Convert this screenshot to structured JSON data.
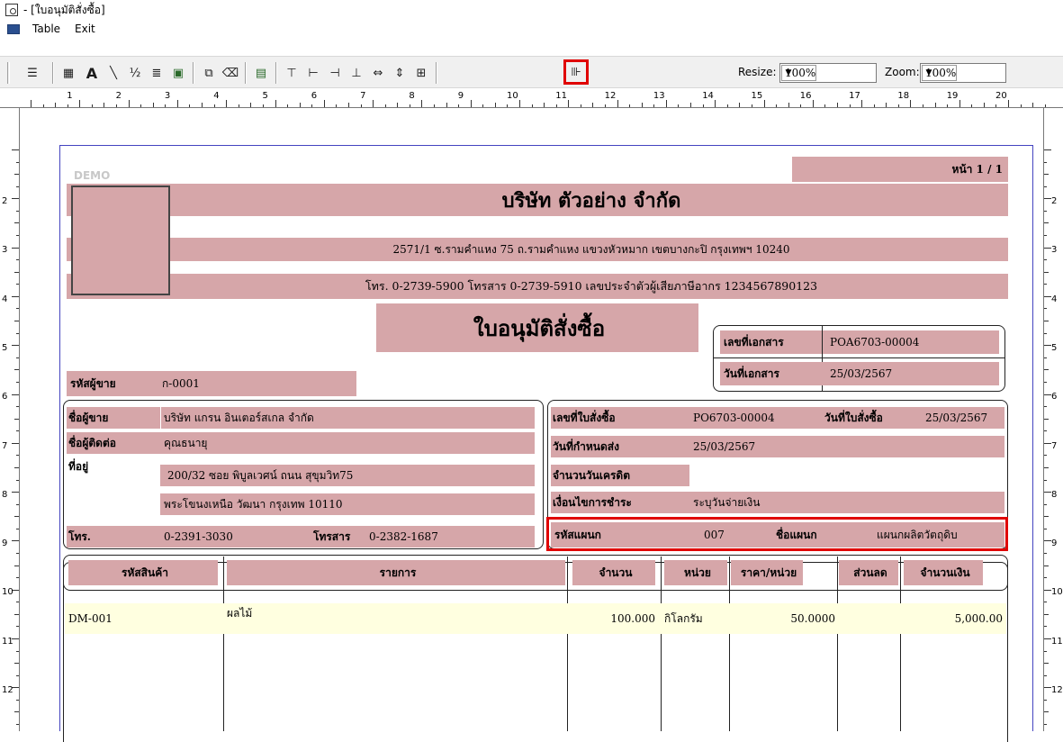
{
  "window": {
    "title": "- [ใบอนุมัติสั่งซื้อ]"
  },
  "menu": {
    "items": [
      "Table",
      "Exit"
    ]
  },
  "toolbar": {
    "resize_label": "Resize:",
    "resize_value": "100%",
    "zoom_label": "Zoom:",
    "zoom_value": "100%"
  },
  "ruler": {
    "h_numbers": [
      "1",
      "2",
      "3",
      "4",
      "5",
      "6",
      "7",
      "8",
      "9",
      "10",
      "11",
      "12",
      "13",
      "14",
      "15",
      "16",
      "17",
      "18",
      "19",
      "20"
    ],
    "v_numbers": [
      "2",
      "3",
      "4",
      "5",
      "6",
      "7",
      "8",
      "9",
      "10",
      "11",
      "12"
    ]
  },
  "report": {
    "watermark": "DEMO",
    "page_label": "หน้า 1 / 1",
    "company_name": "บริษัท ตัวอย่าง จำกัด",
    "address": "2571/1 ซ.รามคำแหง 75 ถ.รามคำแหง แขวงหัวหมาก เขตบางกะปิ กรุงเทพฯ 10240",
    "contact": "โทร. 0-2739-5900  โทรสาร 0-2739-5910  เลขประจำตัวผู้เสียภาษีอากร 1234567890123",
    "doc_title": "ใบอนุมัติสั่งซื้อ",
    "doc_no_label": "เลขที่เอกสาร",
    "doc_no": "POA6703-00004",
    "doc_date_label": "วันที่เอกสาร",
    "doc_date": "25/03/2567",
    "vendor_code_label": "รหัสผู้ขาย",
    "vendor_code": "ก-0001",
    "vendor_name_label": "ชื่อผู้ขาย",
    "vendor_name": "บริษัท แกรน อินเตอร์สเกล จำกัด",
    "contact_label": "ชื่อผู้ติดต่อ",
    "contact_name": "คุณธนายุ",
    "address_label": "ที่อยู่",
    "vendor_address1": "200/32  ซอย พิบูลเวศน์ ถนน สุขุมวิท75",
    "vendor_address2": "พระโขนงเหนือ วัฒนา กรุงเทพ 10110",
    "tel_label": "โทร.",
    "tel": "0-2391-3030",
    "fax_label": "โทรสาร",
    "fax": "0-2382-1687",
    "po_no_label": "เลขที่ใบสั่งซื้อ",
    "po_no": "PO6703-00004",
    "po_date_label": "วันที่ใบสั่งซื้อ",
    "po_date": "25/03/2567",
    "due_date_label": "วันที่กำหนดส่ง",
    "due_date": "25/03/2567",
    "credit_days_label": "จำนวนวันเครดิต",
    "credit_days": "",
    "payment_label": "เงื่อนไขการชำระ",
    "payment": "ระบุวันจ่ายเงิน",
    "dept_code_label": "รหัสแผนก",
    "dept_code": "007",
    "dept_name_label": "ชื่อแผนก",
    "dept_name": "แผนกผลิตวัตถุดิบ",
    "columns": [
      "รหัสสินค้า",
      "รายการ",
      "จำนวน",
      "หน่วย",
      "ราคา/หน่วย",
      "ส่วนลด",
      "จำนวนเงิน"
    ],
    "rows": [
      {
        "code": "DM-001",
        "desc": "ผลไม้",
        "qty": "100.000",
        "unit": "กิโลกรัม",
        "price": "50.0000",
        "discount": "",
        "amount": "5,000.00"
      }
    ]
  },
  "colors": {
    "field_bg": "#d6a6a9",
    "highlight": "#e00000",
    "row_bg": "#ffffe0",
    "page_border": "#4444c0"
  }
}
